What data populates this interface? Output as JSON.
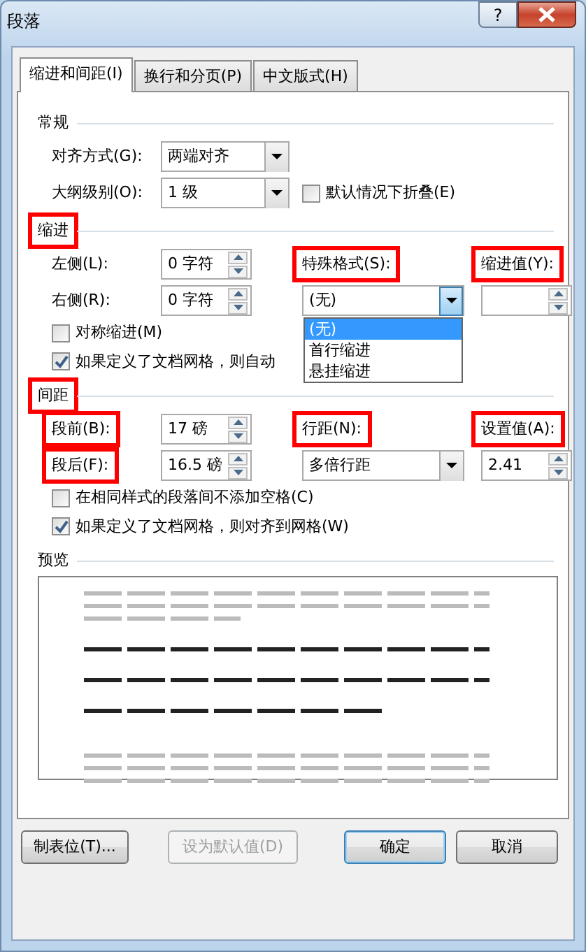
{
  "window": {
    "title": "段落",
    "help": "?"
  },
  "tabs": [
    {
      "label": "缩进和间距(I)",
      "selected": true
    },
    {
      "label": "换行和分页(P)",
      "selected": false
    },
    {
      "label": "中文版式(H)",
      "selected": false
    }
  ],
  "sections": [
    {
      "title": "常规",
      "rows": [
        [
          {
            "kind": "label",
            "text": "对齐方式(G):",
            "highlighted": false
          },
          {
            "kind": "select",
            "value": "两端对齐"
          }
        ],
        [
          {
            "kind": "label",
            "text": "大纲级别(O):",
            "highlighted": false
          },
          {
            "kind": "select",
            "value": "1 级"
          },
          {
            "kind": "checkbox",
            "text": "默认情况下折叠(E)",
            "checked": false
          }
        ]
      ]
    },
    {
      "title": "缩进",
      "highlighted": true,
      "rows": [
        [
          {
            "kind": "label",
            "text": "左侧(L):",
            "highlighted": false
          },
          {
            "kind": "spin",
            "value": "0 字符"
          },
          {
            "kind": "label",
            "text": "特殊格式(S):",
            "highlighted": true
          },
          {
            "kind": "label",
            "text": "缩进值(Y):",
            "highlighted": true
          }
        ],
        [
          {
            "kind": "label",
            "text": "右侧(R):",
            "highlighted": false
          },
          {
            "kind": "spin",
            "value": "0 字符"
          },
          {
            "kind": "select",
            "value": "(无)",
            "open": true,
            "options": [
              {
                "text": "(无)",
                "selected": true
              },
              {
                "text": "首行缩进",
                "selected": false
              },
              {
                "text": "悬挂缩进",
                "selected": false
              }
            ]
          },
          {
            "kind": "spin"
          }
        ],
        [
          {
            "kind": "checkbox",
            "text": "对称缩进(M)",
            "checked": false
          }
        ],
        [
          {
            "kind": "checkbox",
            "text": "如果定义了文档网格，则自动",
            "checked": true
          }
        ]
      ]
    },
    {
      "title": "间距",
      "highlighted": true,
      "rows": [
        [
          {
            "kind": "label",
            "text": "段前(B):",
            "highlighted": true
          },
          {
            "kind": "spin",
            "value": "17 磅"
          },
          {
            "kind": "label",
            "text": "行距(N):",
            "highlighted": true
          },
          {
            "kind": "label",
            "text": "设置值(A):",
            "highlighted": true
          }
        ],
        [
          {
            "kind": "label",
            "text": "段后(F):",
            "highlighted": true
          },
          {
            "kind": "spin",
            "value": "16.5 磅"
          },
          {
            "kind": "select",
            "value": "多倍行距"
          },
          {
            "kind": "spin",
            "value": "2.41"
          }
        ],
        [
          {
            "kind": "checkbox",
            "text": "在相同样式的段落间不添加空格(C)",
            "checked": false
          }
        ],
        [
          {
            "kind": "checkbox",
            "text": "如果定义了文档网格，则对齐到网格(W)",
            "checked": true
          }
        ]
      ]
    },
    {
      "title": "预览",
      "rows": [
        [
          {
            "kind": "preview"
          }
        ]
      ]
    }
  ],
  "buttons": [
    {
      "label": "制表位(T)...",
      "disabled": false,
      "default": false
    },
    {
      "label": "设为默认值(D)",
      "disabled": true,
      "default": false
    },
    {
      "label": "确定",
      "disabled": false,
      "default": true
    },
    {
      "label": "取消",
      "disabled": false,
      "default": false
    }
  ]
}
